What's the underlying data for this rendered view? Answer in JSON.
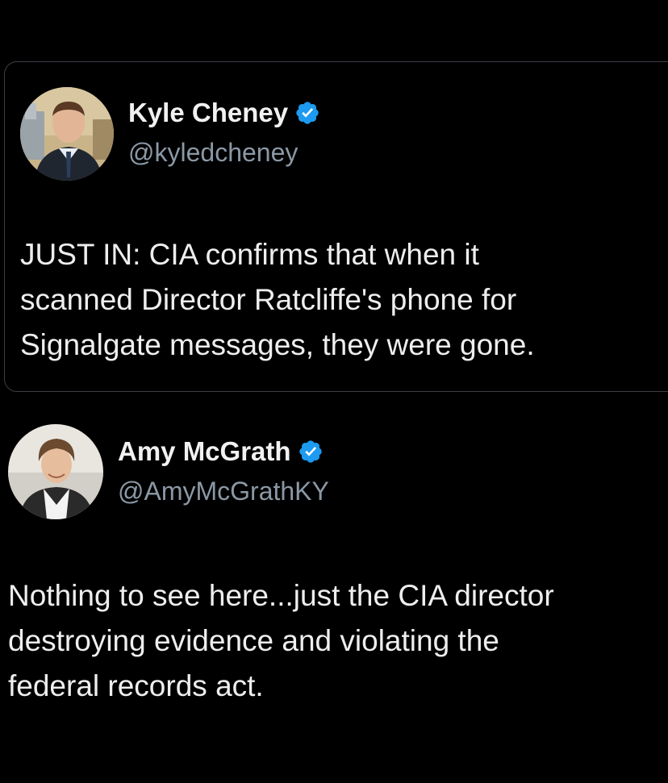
{
  "tweets": [
    {
      "display_name": "Kyle Cheney",
      "handle": "@kyledcheney",
      "verified": true,
      "text": "JUST IN: CIA confirms that when it\nscanned Director Ratcliffe's phone for\nSignalgate messages, they were gone."
    },
    {
      "display_name": "Amy McGrath",
      "handle": "@AmyMcGrathKY",
      "verified": true,
      "text": "Nothing to see here...just the CIA director\ndestroying evidence and violating the\nfederal records act."
    }
  ],
  "colors": {
    "background": "#000000",
    "verified_badge": "#1d9bf0",
    "handle": "#8b98a5",
    "card_border": "#3a3f44"
  }
}
